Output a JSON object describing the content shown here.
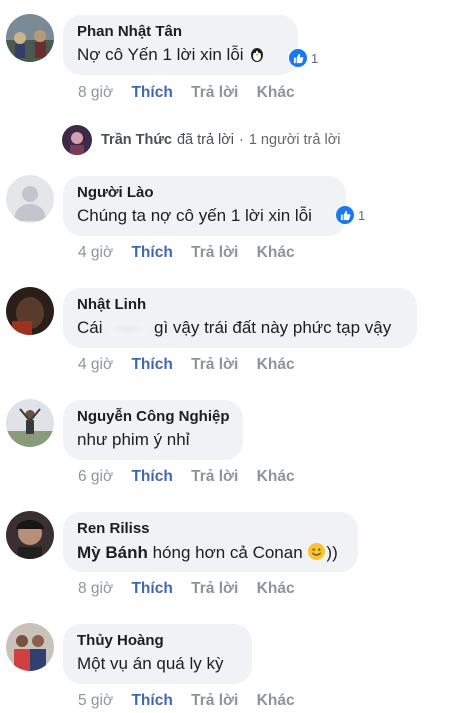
{
  "actions": {
    "like": "Thích",
    "reply": "Trả lời",
    "more": "Khác"
  },
  "reply_summary": {
    "name": "Trần Thức",
    "verb": "đã trả lời",
    "count_text": "1 người trả lời"
  },
  "comments": [
    {
      "author": "Phan Nhật Tân",
      "text": "Nợ cô Yến 1 lời xin lỗi",
      "emoji": "penguin",
      "time": "8 giờ",
      "reaction": "like-icon",
      "reaction_count": "1"
    },
    {
      "author": "Người Lào",
      "text": "Chúng ta nợ cô yến 1 lời xin lỗi",
      "time": "4 giờ",
      "reaction": "like-icon",
      "reaction_count": "1"
    },
    {
      "author": "Nhật Linh",
      "text_before": "Cái",
      "text_after": "gì vậy trái đất này phức tạp vậy",
      "time": "4 giờ"
    },
    {
      "author": "Nguyễn Công Nghiệp",
      "text": "như phim ý nhỉ",
      "time": "6 giờ"
    },
    {
      "author": "Ren Riliss",
      "mention": "Mỳ Bánh",
      "text_after": "hóng hơn cả Conan",
      "emoji": "smile",
      "text_tail": "))",
      "time": "8 giờ"
    },
    {
      "author": "Thủy Hoàng",
      "text": "Một vụ án quá ly kỳ",
      "time": "5 giờ"
    }
  ],
  "colors": {
    "bubble": "#f0f2f5",
    "like": "#4267b2",
    "meta": "#8d949e",
    "badge": "#1877f2"
  }
}
